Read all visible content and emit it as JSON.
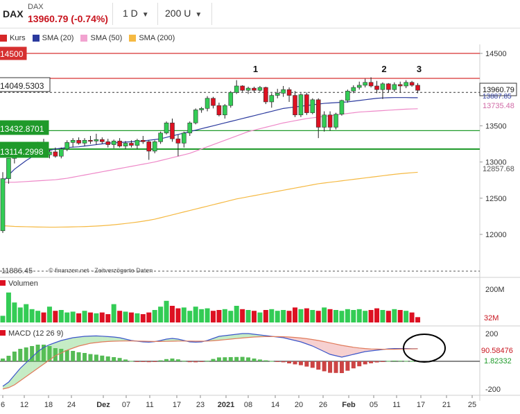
{
  "toolbar": {
    "instrument": "DAX",
    "instrument_small": "DAX",
    "price_change": "13960.79 (-0.74%)",
    "interval": "1 D",
    "range": "200 U"
  },
  "legend": [
    {
      "label": "Kurs",
      "color": "#d62728"
    },
    {
      "label": "SMA (20)",
      "color": "#2b3a9e"
    },
    {
      "label": "SMA (50)",
      "color": "#f2a3d0"
    },
    {
      "label": "SMA (200)",
      "color": "#f5b942"
    }
  ],
  "colors": {
    "up": "#33cc55",
    "down": "#dd1122",
    "sma20": "#2b3a9e",
    "sma50": "#ee88c8",
    "sma200": "#f5b942",
    "support": "#1f9a2a",
    "resistance": "#d63030"
  },
  "price_axis_ticks": [
    "14500",
    "14000",
    "13500",
    "13000",
    "12500",
    "12000"
  ],
  "level_labels": {
    "resistance_main": "14500",
    "resistance_box": "14049.5303",
    "support_1": "13432.8701",
    "support_2": "13114.2998",
    "low_cut": "11886.45",
    "current_price": "13960.79",
    "sma20_value": "13887.85",
    "sma50_value": "13735.48",
    "sma200_value": "12857.68"
  },
  "peak_markers": [
    "1",
    "2",
    "3"
  ],
  "watermark": "© finanzen.net · Zeitverzögerte Daten",
  "volume": {
    "label": "Volumen",
    "ticks": [
      "200M"
    ],
    "value_label": "32M"
  },
  "macd": {
    "label": "MACD (12 26 9)",
    "ticks": [
      "200",
      "-200"
    ],
    "value_label": "90.58476",
    "signal_label": "1.82332"
  },
  "x_axis_ticks": [
    "6",
    "12",
    "18",
    "24",
    "Dez",
    "07",
    "11",
    "17",
    "23",
    "2021",
    "08",
    "14",
    "20",
    "26",
    "Feb",
    "05",
    "11",
    "17",
    "21",
    "25"
  ],
  "chart_data": {
    "type": "candlestick",
    "y_range": [
      11900,
      14650
    ],
    "candles": [
      {
        "o": 12050,
        "h": 12860,
        "l": 12020,
        "c": 12770
      },
      {
        "o": 12770,
        "h": 13000,
        "l": 12700,
        "c": 13050
      },
      {
        "o": 13050,
        "h": 13150,
        "l": 12980,
        "c": 13120
      },
      {
        "o": 13120,
        "h": 13200,
        "l": 13070,
        "c": 13150
      },
      {
        "o": 13150,
        "h": 13240,
        "l": 13080,
        "c": 13200
      },
      {
        "o": 13200,
        "h": 13260,
        "l": 13120,
        "c": 13230
      },
      {
        "o": 13230,
        "h": 13280,
        "l": 13150,
        "c": 13260
      },
      {
        "o": 13260,
        "h": 13320,
        "l": 13080,
        "c": 13100
      },
      {
        "o": 13100,
        "h": 13170,
        "l": 13050,
        "c": 13140
      },
      {
        "o": 13140,
        "h": 13200,
        "l": 13060,
        "c": 13080
      },
      {
        "o": 13080,
        "h": 13200,
        "l": 13050,
        "c": 13180
      },
      {
        "o": 13180,
        "h": 13300,
        "l": 13150,
        "c": 13270
      },
      {
        "o": 13270,
        "h": 13330,
        "l": 13200,
        "c": 13300
      },
      {
        "o": 13300,
        "h": 13340,
        "l": 13240,
        "c": 13260
      },
      {
        "o": 13260,
        "h": 13330,
        "l": 13220,
        "c": 13300
      },
      {
        "o": 13300,
        "h": 13360,
        "l": 13250,
        "c": 13290
      },
      {
        "o": 13290,
        "h": 13390,
        "l": 13240,
        "c": 13310
      },
      {
        "o": 13310,
        "h": 13340,
        "l": 13250,
        "c": 13280
      },
      {
        "o": 13280,
        "h": 13320,
        "l": 13200,
        "c": 13240
      },
      {
        "o": 13240,
        "h": 13310,
        "l": 13190,
        "c": 13290
      },
      {
        "o": 13290,
        "h": 13330,
        "l": 13200,
        "c": 13220
      },
      {
        "o": 13220,
        "h": 13290,
        "l": 13180,
        "c": 13260
      },
      {
        "o": 13260,
        "h": 13300,
        "l": 13200,
        "c": 13230
      },
      {
        "o": 13230,
        "h": 13320,
        "l": 13180,
        "c": 13300
      },
      {
        "o": 13300,
        "h": 13360,
        "l": 13250,
        "c": 13280
      },
      {
        "o": 13280,
        "h": 13300,
        "l": 13030,
        "c": 13150
      },
      {
        "o": 13150,
        "h": 13300,
        "l": 13120,
        "c": 13280
      },
      {
        "o": 13280,
        "h": 13420,
        "l": 13250,
        "c": 13400
      },
      {
        "o": 13400,
        "h": 13560,
        "l": 13380,
        "c": 13540
      },
      {
        "o": 13540,
        "h": 13600,
        "l": 13280,
        "c": 13320
      },
      {
        "o": 13320,
        "h": 13380,
        "l": 13080,
        "c": 13260
      },
      {
        "o": 13260,
        "h": 13420,
        "l": 13200,
        "c": 13400
      },
      {
        "o": 13400,
        "h": 13560,
        "l": 13360,
        "c": 13540
      },
      {
        "o": 13540,
        "h": 13740,
        "l": 13520,
        "c": 13720
      },
      {
        "o": 13720,
        "h": 13760,
        "l": 13680,
        "c": 13740
      },
      {
        "o": 13740,
        "h": 13910,
        "l": 13700,
        "c": 13880
      },
      {
        "o": 13880,
        "h": 13900,
        "l": 13740,
        "c": 13780
      },
      {
        "o": 13780,
        "h": 13820,
        "l": 13630,
        "c": 13650
      },
      {
        "o": 13650,
        "h": 13800,
        "l": 13600,
        "c": 13780
      },
      {
        "o": 13780,
        "h": 13980,
        "l": 13750,
        "c": 13960
      },
      {
        "o": 13960,
        "h": 14130,
        "l": 13940,
        "c": 14050
      },
      {
        "o": 14050,
        "h": 14060,
        "l": 13970,
        "c": 13990
      },
      {
        "o": 13990,
        "h": 14040,
        "l": 13940,
        "c": 14020
      },
      {
        "o": 14020,
        "h": 14040,
        "l": 13960,
        "c": 13990
      },
      {
        "o": 13990,
        "h": 14050,
        "l": 13970,
        "c": 14030
      },
      {
        "o": 14030,
        "h": 14040,
        "l": 13800,
        "c": 13830
      },
      {
        "o": 13830,
        "h": 13950,
        "l": 13750,
        "c": 13920
      },
      {
        "o": 13920,
        "h": 14010,
        "l": 13880,
        "c": 13950
      },
      {
        "o": 13950,
        "h": 14050,
        "l": 13900,
        "c": 14000
      },
      {
        "o": 14000,
        "h": 14030,
        "l": 13830,
        "c": 13920
      },
      {
        "o": 13920,
        "h": 13980,
        "l": 13620,
        "c": 13650
      },
      {
        "o": 13650,
        "h": 13950,
        "l": 13620,
        "c": 13930
      },
      {
        "o": 13930,
        "h": 13960,
        "l": 13650,
        "c": 13680
      },
      {
        "o": 13680,
        "h": 13880,
        "l": 13660,
        "c": 13860
      },
      {
        "o": 13860,
        "h": 13880,
        "l": 13330,
        "c": 13480
      },
      {
        "o": 13480,
        "h": 13700,
        "l": 13420,
        "c": 13650
      },
      {
        "o": 13650,
        "h": 13700,
        "l": 13430,
        "c": 13480
      },
      {
        "o": 13480,
        "h": 13680,
        "l": 13450,
        "c": 13660
      },
      {
        "o": 13660,
        "h": 13860,
        "l": 13640,
        "c": 13850
      },
      {
        "o": 13850,
        "h": 14000,
        "l": 13820,
        "c": 13980
      },
      {
        "o": 13980,
        "h": 14060,
        "l": 13950,
        "c": 14030
      },
      {
        "o": 14030,
        "h": 14110,
        "l": 14000,
        "c": 14060
      },
      {
        "o": 14060,
        "h": 14150,
        "l": 14030,
        "c": 14100
      },
      {
        "o": 14100,
        "h": 14170,
        "l": 14030,
        "c": 14050
      },
      {
        "o": 14050,
        "h": 14120,
        "l": 13950,
        "c": 14000
      },
      {
        "o": 14000,
        "h": 14100,
        "l": 13870,
        "c": 14080
      },
      {
        "o": 14080,
        "h": 14090,
        "l": 13960,
        "c": 14000
      },
      {
        "o": 14000,
        "h": 14100,
        "l": 13970,
        "c": 14070
      },
      {
        "o": 14070,
        "h": 14110,
        "l": 13960,
        "c": 14050
      },
      {
        "o": 14050,
        "h": 14130,
        "l": 14020,
        "c": 14100
      },
      {
        "o": 14100,
        "h": 14120,
        "l": 14040,
        "c": 14060
      },
      {
        "o": 14060,
        "h": 14090,
        "l": 13950,
        "c": 13990
      }
    ],
    "sma20": [
      12720,
      12820,
      12900,
      12960,
      13020,
      13070,
      13110,
      13140,
      13160,
      13180,
      13190,
      13200,
      13205,
      13210,
      13220,
      13230,
      13240,
      13250,
      13260,
      13265,
      13270,
      13275,
      13280,
      13285,
      13290,
      13300,
      13310,
      13320,
      13340,
      13360,
      13380,
      13400,
      13420,
      13440,
      13460,
      13480,
      13500,
      13520,
      13540,
      13560,
      13580,
      13600,
      13620,
      13640,
      13660,
      13680,
      13700,
      13720,
      13740,
      13750,
      13760,
      13770,
      13780,
      13790,
      13800,
      13810,
      13815,
      13820,
      13825,
      13830,
      13840,
      13850,
      13860,
      13870,
      13880,
      13885,
      13888,
      13890,
      13890,
      13890,
      13888,
      13887.85
    ],
    "sma50": [
      12720,
      12720,
      12720,
      12725,
      12730,
      12735,
      12740,
      12745,
      12750,
      12755,
      12765,
      12775,
      12790,
      12805,
      12820,
      12835,
      12850,
      12865,
      12880,
      12895,
      12910,
      12925,
      12940,
      12955,
      12970,
      12985,
      13000,
      13020,
      13040,
      13060,
      13080,
      13100,
      13120,
      13150,
      13180,
      13210,
      13240,
      13270,
      13300,
      13330,
      13360,
      13390,
      13420,
      13440,
      13460,
      13480,
      13500,
      13520,
      13540,
      13555,
      13570,
      13585,
      13600,
      13610,
      13620,
      13630,
      13640,
      13650,
      13660,
      13670,
      13680,
      13690,
      13695,
      13700,
      13705,
      13710,
      13715,
      13720,
      13725,
      13730,
      13733,
      13735.48
    ],
    "sma200": [
      12120,
      12115,
      12110,
      12108,
      12106,
      12104,
      12102,
      12101,
      12100,
      12100,
      12101,
      12102,
      12104,
      12106,
      12108,
      12111,
      12115,
      12120,
      12126,
      12133,
      12141,
      12150,
      12160,
      12170,
      12182,
      12195,
      12210,
      12230,
      12250,
      12270,
      12290,
      12310,
      12330,
      12350,
      12370,
      12390,
      12410,
      12430,
      12450,
      12470,
      12490,
      12505,
      12520,
      12535,
      12550,
      12565,
      12580,
      12595,
      12610,
      12625,
      12640,
      12655,
      12670,
      12685,
      12700,
      12710,
      12720,
      12730,
      12740,
      12750,
      12760,
      12770,
      12780,
      12790,
      12800,
      12810,
      12820,
      12830,
      12838,
      12845,
      12852,
      12857.68
    ],
    "volume": [
      40,
      180,
      120,
      90,
      110,
      80,
      70,
      60,
      95,
      70,
      75,
      60,
      65,
      55,
      70,
      60,
      55,
      60,
      50,
      110,
      70,
      65,
      60,
      55,
      50,
      60,
      75,
      95,
      130,
      100,
      85,
      90,
      70,
      95,
      80,
      85,
      70,
      75,
      80,
      70,
      100,
      80,
      75,
      70,
      60,
      75,
      80,
      70,
      75,
      70,
      90,
      80,
      85,
      75,
      70,
      90,
      80,
      75,
      70,
      80,
      75,
      80,
      70,
      75,
      85,
      75,
      70,
      80,
      75,
      70,
      60,
      32
    ],
    "macd_line": [
      -180,
      -150,
      -100,
      -50,
      -10,
      30,
      70,
      100,
      120,
      135,
      150,
      160,
      170,
      175,
      180,
      182,
      183,
      181,
      178,
      175,
      170,
      160,
      150,
      145,
      140,
      138,
      142,
      150,
      160,
      165,
      160,
      150,
      140,
      138,
      140,
      150,
      165,
      180,
      185,
      190,
      195,
      200,
      200,
      195,
      190,
      185,
      180,
      175,
      170,
      160,
      150,
      140,
      125,
      110,
      90,
      70,
      50,
      40,
      30,
      40,
      50,
      60,
      70,
      75,
      80,
      85,
      90,
      92,
      92,
      92,
      91,
      90.58
    ],
    "macd_signal": [
      -200,
      -190,
      -170,
      -140,
      -110,
      -80,
      -50,
      -20,
      10,
      40,
      60,
      80,
      95,
      110,
      120,
      130,
      135,
      140,
      143,
      145,
      146,
      147,
      147,
      146,
      145,
      144,
      143,
      143,
      144,
      145,
      146,
      146,
      146,
      145,
      145,
      146,
      148,
      152,
      156,
      160,
      164,
      168,
      172,
      175,
      177,
      178,
      178,
      178,
      177,
      175,
      172,
      168,
      163,
      157,
      150,
      142,
      133,
      124,
      115,
      108,
      101,
      96,
      92,
      89,
      88,
      87,
      87,
      87,
      88,
      89,
      89.5,
      90
    ],
    "macd_hist": [
      20,
      40,
      70,
      90,
      100,
      110,
      120,
      120,
      110,
      95,
      90,
      80,
      75,
      65,
      60,
      52,
      48,
      41,
      35,
      30,
      24,
      13,
      3,
      -1,
      -5,
      -6,
      -1,
      7,
      16,
      20,
      14,
      4,
      -6,
      -7,
      -5,
      4,
      17,
      28,
      29,
      30,
      31,
      32,
      28,
      20,
      13,
      7,
      2,
      -3,
      -7,
      -15,
      -22,
      -28,
      -38,
      -47,
      -60,
      -72,
      -83,
      -84,
      -85,
      -68,
      -51,
      -36,
      -22,
      -14,
      -8,
      -2,
      3,
      5,
      4,
      3,
      2,
      1.82
    ]
  }
}
